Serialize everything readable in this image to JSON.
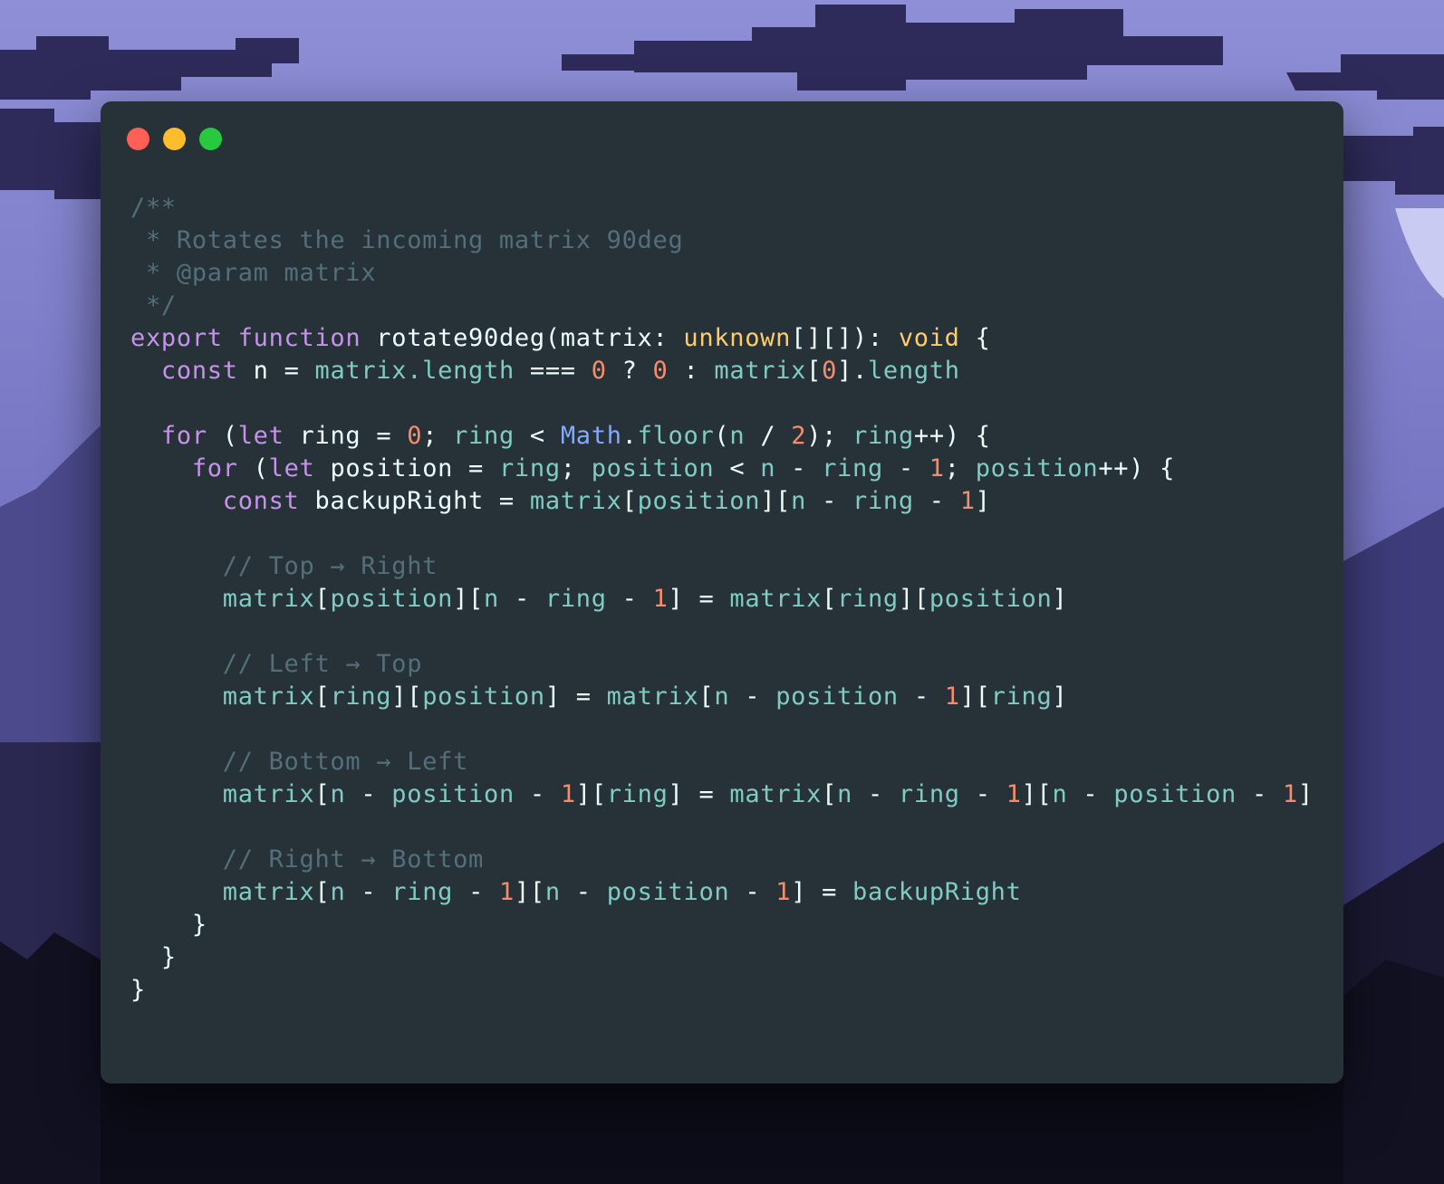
{
  "window": {
    "buttons": [
      {
        "name": "close",
        "color": "#ff5f56"
      },
      {
        "name": "minimize",
        "color": "#ffbd2e"
      },
      {
        "name": "zoom",
        "color": "#27c93f"
      }
    ],
    "background_color": "#263238"
  },
  "theme": {
    "comment": "#546e7a",
    "keyword": "#c792ea",
    "type": "#ffcb6b",
    "number": "#f78c6c",
    "variable": "#80cbc4",
    "builtin": "#82aaff",
    "plain": "#eeffff"
  },
  "code": {
    "language": "typescript",
    "lines": [
      [
        {
          "t": "comment",
          "v": "/**"
        }
      ],
      [
        {
          "t": "comment",
          "v": " * Rotates the incoming matrix 90deg"
        }
      ],
      [
        {
          "t": "comment",
          "v": " * @param matrix"
        }
      ],
      [
        {
          "t": "comment",
          "v": " */"
        }
      ],
      [
        {
          "t": "keyword",
          "v": "export function "
        },
        {
          "t": "plain",
          "v": "rotate90deg(matrix: "
        },
        {
          "t": "type",
          "v": "unknown"
        },
        {
          "t": "plain",
          "v": "[][]): "
        },
        {
          "t": "type",
          "v": "void"
        },
        {
          "t": "plain",
          "v": " {"
        }
      ],
      [
        {
          "t": "plain",
          "v": "  "
        },
        {
          "t": "keyword",
          "v": "const"
        },
        {
          "t": "plain",
          "v": " n = "
        },
        {
          "t": "var",
          "v": "matrix.length"
        },
        {
          "t": "plain",
          "v": " === "
        },
        {
          "t": "number",
          "v": "0"
        },
        {
          "t": "plain",
          "v": " ? "
        },
        {
          "t": "number",
          "v": "0"
        },
        {
          "t": "plain",
          "v": " : "
        },
        {
          "t": "var",
          "v": "matrix"
        },
        {
          "t": "plain",
          "v": "["
        },
        {
          "t": "number",
          "v": "0"
        },
        {
          "t": "plain",
          "v": "]."
        },
        {
          "t": "var",
          "v": "length"
        }
      ],
      [],
      [
        {
          "t": "plain",
          "v": "  "
        },
        {
          "t": "keyword",
          "v": "for"
        },
        {
          "t": "plain",
          "v": " ("
        },
        {
          "t": "keyword",
          "v": "let"
        },
        {
          "t": "plain",
          "v": " ring = "
        },
        {
          "t": "number",
          "v": "0"
        },
        {
          "t": "plain",
          "v": "; "
        },
        {
          "t": "var",
          "v": "ring"
        },
        {
          "t": "plain",
          "v": " < "
        },
        {
          "t": "builtin",
          "v": "Math"
        },
        {
          "t": "plain",
          "v": "."
        },
        {
          "t": "var",
          "v": "floor"
        },
        {
          "t": "plain",
          "v": "("
        },
        {
          "t": "var",
          "v": "n"
        },
        {
          "t": "plain",
          "v": " / "
        },
        {
          "t": "number",
          "v": "2"
        },
        {
          "t": "plain",
          "v": "); "
        },
        {
          "t": "var",
          "v": "ring"
        },
        {
          "t": "plain",
          "v": "++) {"
        }
      ],
      [
        {
          "t": "plain",
          "v": "    "
        },
        {
          "t": "keyword",
          "v": "for"
        },
        {
          "t": "plain",
          "v": " ("
        },
        {
          "t": "keyword",
          "v": "let"
        },
        {
          "t": "plain",
          "v": " position = "
        },
        {
          "t": "var",
          "v": "ring"
        },
        {
          "t": "plain",
          "v": "; "
        },
        {
          "t": "var",
          "v": "position"
        },
        {
          "t": "plain",
          "v": " < "
        },
        {
          "t": "var",
          "v": "n"
        },
        {
          "t": "plain",
          "v": " - "
        },
        {
          "t": "var",
          "v": "ring"
        },
        {
          "t": "plain",
          "v": " - "
        },
        {
          "t": "number",
          "v": "1"
        },
        {
          "t": "plain",
          "v": "; "
        },
        {
          "t": "var",
          "v": "position"
        },
        {
          "t": "plain",
          "v": "++) {"
        }
      ],
      [
        {
          "t": "plain",
          "v": "      "
        },
        {
          "t": "keyword",
          "v": "const"
        },
        {
          "t": "plain",
          "v": " backupRight = "
        },
        {
          "t": "var",
          "v": "matrix"
        },
        {
          "t": "plain",
          "v": "["
        },
        {
          "t": "var",
          "v": "position"
        },
        {
          "t": "plain",
          "v": "]["
        },
        {
          "t": "var",
          "v": "n"
        },
        {
          "t": "plain",
          "v": " - "
        },
        {
          "t": "var",
          "v": "ring"
        },
        {
          "t": "plain",
          "v": " - "
        },
        {
          "t": "number",
          "v": "1"
        },
        {
          "t": "plain",
          "v": "]"
        }
      ],
      [],
      [
        {
          "t": "comment",
          "v": "      // Top → Right"
        }
      ],
      [
        {
          "t": "plain",
          "v": "      "
        },
        {
          "t": "var",
          "v": "matrix"
        },
        {
          "t": "plain",
          "v": "["
        },
        {
          "t": "var",
          "v": "position"
        },
        {
          "t": "plain",
          "v": "]["
        },
        {
          "t": "var",
          "v": "n"
        },
        {
          "t": "plain",
          "v": " - "
        },
        {
          "t": "var",
          "v": "ring"
        },
        {
          "t": "plain",
          "v": " - "
        },
        {
          "t": "number",
          "v": "1"
        },
        {
          "t": "plain",
          "v": "] = "
        },
        {
          "t": "var",
          "v": "matrix"
        },
        {
          "t": "plain",
          "v": "["
        },
        {
          "t": "var",
          "v": "ring"
        },
        {
          "t": "plain",
          "v": "]["
        },
        {
          "t": "var",
          "v": "position"
        },
        {
          "t": "plain",
          "v": "]"
        }
      ],
      [],
      [
        {
          "t": "comment",
          "v": "      // Left → Top"
        }
      ],
      [
        {
          "t": "plain",
          "v": "      "
        },
        {
          "t": "var",
          "v": "matrix"
        },
        {
          "t": "plain",
          "v": "["
        },
        {
          "t": "var",
          "v": "ring"
        },
        {
          "t": "plain",
          "v": "]["
        },
        {
          "t": "var",
          "v": "position"
        },
        {
          "t": "plain",
          "v": "] = "
        },
        {
          "t": "var",
          "v": "matrix"
        },
        {
          "t": "plain",
          "v": "["
        },
        {
          "t": "var",
          "v": "n"
        },
        {
          "t": "plain",
          "v": " - "
        },
        {
          "t": "var",
          "v": "position"
        },
        {
          "t": "plain",
          "v": " - "
        },
        {
          "t": "number",
          "v": "1"
        },
        {
          "t": "plain",
          "v": "]["
        },
        {
          "t": "var",
          "v": "ring"
        },
        {
          "t": "plain",
          "v": "]"
        }
      ],
      [],
      [
        {
          "t": "comment",
          "v": "      // Bottom → Left"
        }
      ],
      [
        {
          "t": "plain",
          "v": "      "
        },
        {
          "t": "var",
          "v": "matrix"
        },
        {
          "t": "plain",
          "v": "["
        },
        {
          "t": "var",
          "v": "n"
        },
        {
          "t": "plain",
          "v": " - "
        },
        {
          "t": "var",
          "v": "position"
        },
        {
          "t": "plain",
          "v": " - "
        },
        {
          "t": "number",
          "v": "1"
        },
        {
          "t": "plain",
          "v": "]["
        },
        {
          "t": "var",
          "v": "ring"
        },
        {
          "t": "plain",
          "v": "] = "
        },
        {
          "t": "var",
          "v": "matrix"
        },
        {
          "t": "plain",
          "v": "["
        },
        {
          "t": "var",
          "v": "n"
        },
        {
          "t": "plain",
          "v": " - "
        },
        {
          "t": "var",
          "v": "ring"
        },
        {
          "t": "plain",
          "v": " - "
        },
        {
          "t": "number",
          "v": "1"
        },
        {
          "t": "plain",
          "v": "]["
        },
        {
          "t": "var",
          "v": "n"
        },
        {
          "t": "plain",
          "v": " - "
        },
        {
          "t": "var",
          "v": "position"
        },
        {
          "t": "plain",
          "v": " - "
        },
        {
          "t": "number",
          "v": "1"
        },
        {
          "t": "plain",
          "v": "]"
        }
      ],
      [],
      [
        {
          "t": "comment",
          "v": "      // Right → Bottom"
        }
      ],
      [
        {
          "t": "plain",
          "v": "      "
        },
        {
          "t": "var",
          "v": "matrix"
        },
        {
          "t": "plain",
          "v": "["
        },
        {
          "t": "var",
          "v": "n"
        },
        {
          "t": "plain",
          "v": " - "
        },
        {
          "t": "var",
          "v": "ring"
        },
        {
          "t": "plain",
          "v": " - "
        },
        {
          "t": "number",
          "v": "1"
        },
        {
          "t": "plain",
          "v": "]["
        },
        {
          "t": "var",
          "v": "n"
        },
        {
          "t": "plain",
          "v": " - "
        },
        {
          "t": "var",
          "v": "position"
        },
        {
          "t": "plain",
          "v": " - "
        },
        {
          "t": "number",
          "v": "1"
        },
        {
          "t": "plain",
          "v": "] = "
        },
        {
          "t": "var",
          "v": "backupRight"
        }
      ],
      [
        {
          "t": "plain",
          "v": "    }"
        }
      ],
      [
        {
          "t": "plain",
          "v": "  }"
        }
      ],
      [
        {
          "t": "plain",
          "v": "}"
        }
      ]
    ]
  }
}
